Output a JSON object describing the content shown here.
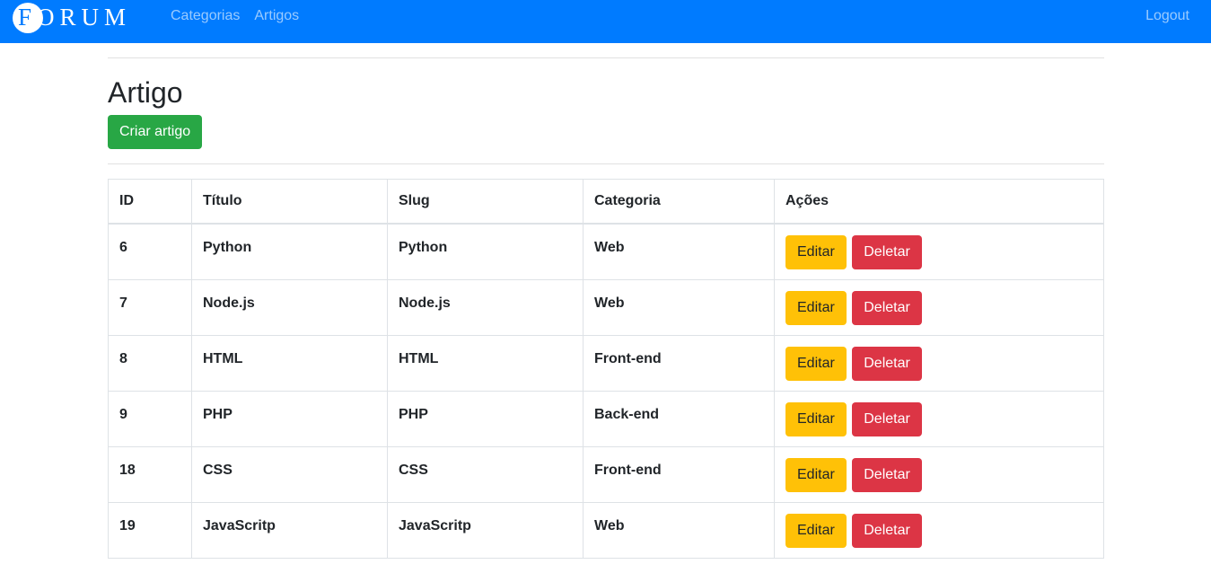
{
  "navbar": {
    "brand": "FORUM",
    "links": [
      "Categorias",
      "Artigos"
    ],
    "logout": "Logout",
    "color": "#007bff"
  },
  "page": {
    "title": "Artigo",
    "create_button": "Criar artigo"
  },
  "table": {
    "headers": [
      "ID",
      "Título",
      "Slug",
      "Categoria",
      "Ações"
    ],
    "rows": [
      {
        "id": "6",
        "titulo": "Python",
        "slug": "Python",
        "categoria": "Web"
      },
      {
        "id": "7",
        "titulo": "Node.js",
        "slug": "Node.js",
        "categoria": "Web"
      },
      {
        "id": "8",
        "titulo": "HTML",
        "slug": "HTML",
        "categoria": "Front-end"
      },
      {
        "id": "9",
        "titulo": "PHP",
        "slug": "PHP",
        "categoria": "Back-end"
      },
      {
        "id": "18",
        "titulo": "CSS",
        "slug": "CSS",
        "categoria": "Front-end"
      },
      {
        "id": "19",
        "titulo": "JavaScritp",
        "slug": "JavaScritp",
        "categoria": "Web"
      }
    ],
    "edit_label": "Editar",
    "delete_label": "Deletar"
  }
}
